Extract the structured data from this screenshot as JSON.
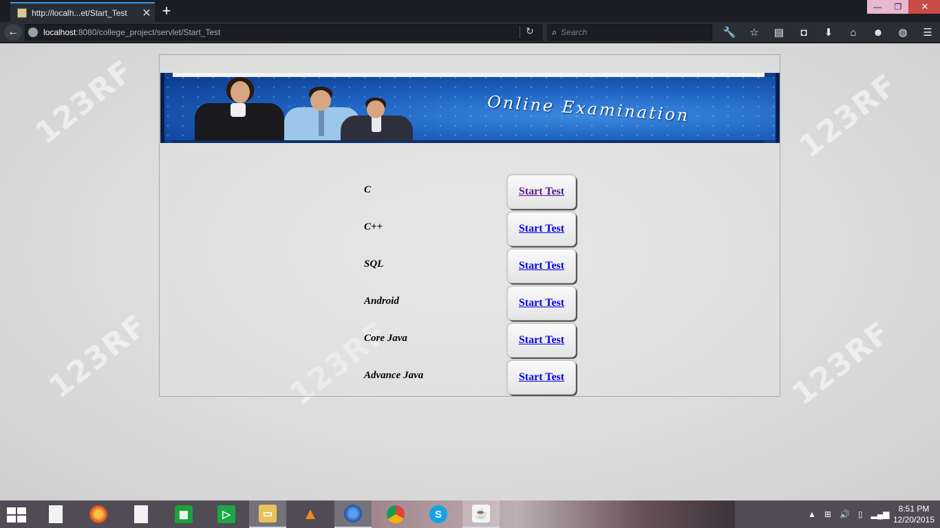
{
  "browser": {
    "tab_title": "http://localh...et/Start_Test",
    "tab_close": "✕",
    "new_tab": "+",
    "window_controls": {
      "minimize": "—",
      "restore": "❐",
      "close": "✕"
    },
    "back": "←",
    "url_host": "localhost",
    "url_path": ":8080/college_project/servlet/Start_Test",
    "reload": "↻",
    "search_placeholder": "Search",
    "toolbar_icons": [
      "wrench-icon",
      "star-icon",
      "reading-list-icon",
      "pocket-icon",
      "download-icon",
      "home-icon",
      "smiley-icon",
      "globe-icon",
      "menu-icon"
    ],
    "toolbar_glyphs": [
      "🔧",
      "☆",
      "▤",
      "◘",
      "⬇",
      "⌂",
      "☻",
      "◍",
      "☰"
    ]
  },
  "page": {
    "banner_title": "Online Examination",
    "watermark": "123RF",
    "start_label": "Start Test",
    "tests": [
      {
        "subject": "C",
        "visited": true
      },
      {
        "subject": "C++",
        "visited": false
      },
      {
        "subject": "SQL",
        "visited": false
      },
      {
        "subject": "Android",
        "visited": false
      },
      {
        "subject": "Core Java",
        "visited": false
      },
      {
        "subject": "Advance Java",
        "visited": false
      }
    ]
  },
  "taskbar": {
    "apps": [
      "start-button",
      "file-icon",
      "chrome-canary-icon",
      "file-icon",
      "store-icon",
      "play-icon",
      "file-explorer-icon",
      "vlc-icon",
      "firefox-icon",
      "chrome-icon",
      "skype-icon",
      "java-icon"
    ],
    "tray_glyphs": [
      "▲",
      "⊞",
      "🔊",
      "▯",
      "▂▄▆"
    ],
    "time": "8:51 PM",
    "date": "12/20/2015"
  },
  "colors": {
    "link": "#0000ee",
    "link_visited": "#551a8b",
    "accent": "#3d9be9"
  }
}
